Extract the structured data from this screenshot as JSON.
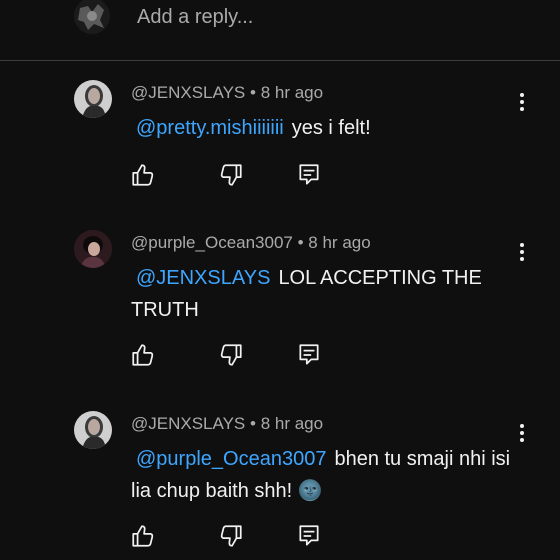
{
  "reply_box": {
    "placeholder": "Add a reply..."
  },
  "comments": [
    {
      "author": "@JENXSLAYS",
      "separator": "•",
      "time": "8 hr ago",
      "mention": "@pretty.mishiiiiiii",
      "text": "yes i felt!"
    },
    {
      "author": "@purple_Ocean3007",
      "separator": "•",
      "time": "8 hr ago",
      "mention": "@JENXSLAYS",
      "text": "LOL ACCEPTING THE TRUTH"
    },
    {
      "author": "@JENXSLAYS",
      "separator": "•",
      "time": "8 hr ago",
      "mention": "@purple_Ocean3007",
      "text": "bhen tu smaji nhi isi lia chup baith shh! 🌚"
    }
  ],
  "icons": {
    "like": "thumbs-up-icon",
    "dislike": "thumbs-down-icon",
    "reply": "reply-icon",
    "more": "more-vertical-icon",
    "avatar": "avatar"
  },
  "colors": {
    "background": "#0f0f0f",
    "mention": "#3ea6ff",
    "meta": "#aaaaaa",
    "text": "#f1f1f1"
  }
}
